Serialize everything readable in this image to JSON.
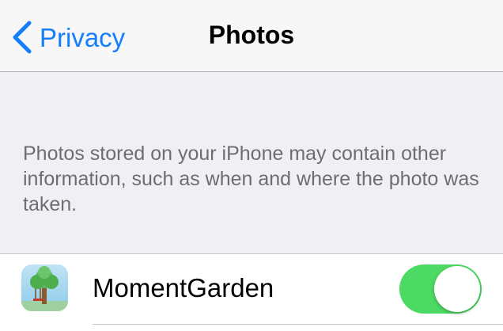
{
  "nav": {
    "back_label": "Privacy",
    "title": "Photos"
  },
  "description": "Photos stored on your iPhone may contain other information, such as when and where the photo was taken.",
  "apps": [
    {
      "name": "MomentGarden",
      "icon": "tree-swing-icon",
      "access_enabled": true
    }
  ],
  "colors": {
    "accent": "#157efb",
    "toggle_on": "#4cd964",
    "background": "#efeff4",
    "secondary_text": "#6d6d72"
  }
}
